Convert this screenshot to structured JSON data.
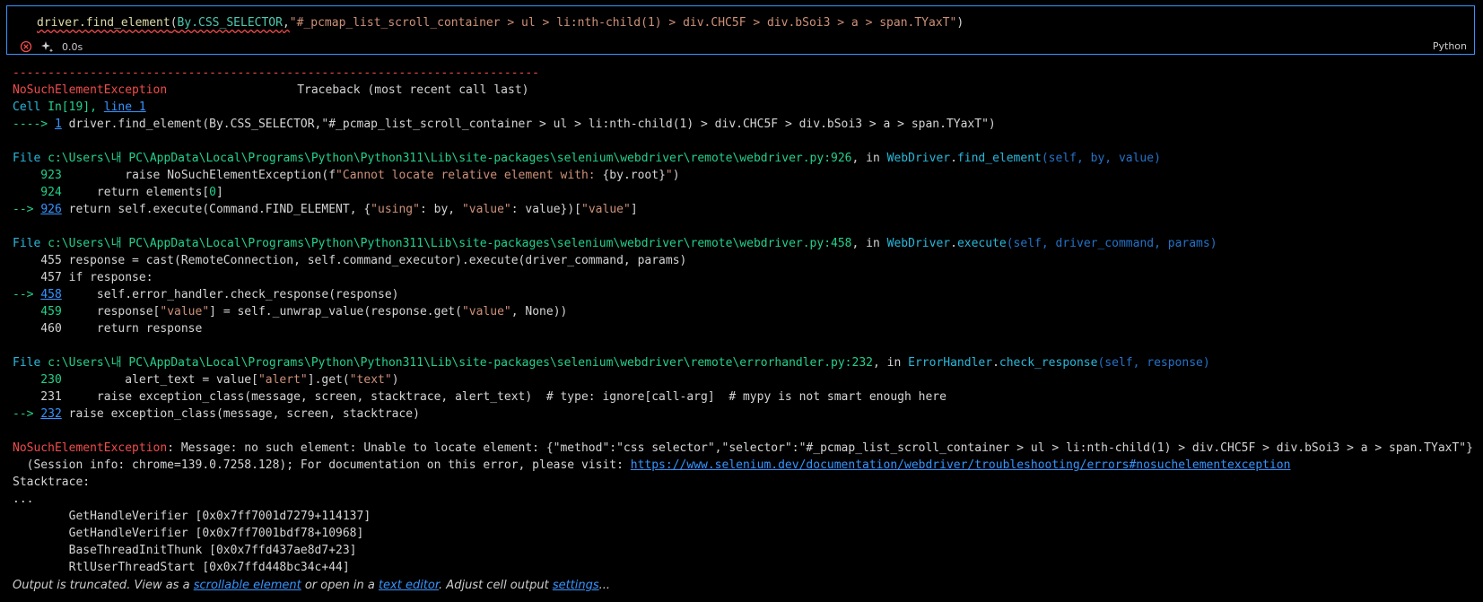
{
  "cell": {
    "code_parts": {
      "fn": "driver.find_element",
      "paren": "(",
      "cls": "By.CSS_SELECTOR",
      "comma": ",",
      "selector": "\"#_pcmap_list_scroll_container > ul > li:nth-child(1) > div.CHC5F > div.bSoi3 > a > span.TYaxT\"",
      "close": ")"
    },
    "exec_time": "0.0s",
    "language": "Python",
    "status": "error"
  },
  "traceback": {
    "dashes": "---------------------------------------------------------------------------",
    "exception_name": "NoSuchElementException",
    "header": "Traceback (most recent call last)",
    "cell_label": "Cell ",
    "cell_in": "In[19], ",
    "cell_line_link": "line 1",
    "arrow_main": "----> ",
    "arrow_main_num": "1",
    "main_code": " driver.find_element(By.CSS_SELECTOR,\"#_pcmap_list_scroll_container > ul > li:nth-child(1) > div.CHC5F > div.bSoi3 > a > span.TYaxT\")",
    "frames": [
      {
        "file_label": "File ",
        "path": "c:\\Users\\내 PC\\AppData\\Local\\Programs\\Python\\Python311\\Lib\\site-packages\\selenium\\webdriver\\remote\\webdriver.py:926",
        "in_text": ", in ",
        "cls": "WebDriver",
        "dot": ".",
        "method": "find_element",
        "args": "(self, by, value)"
      },
      {
        "file_label": "File ",
        "path": "c:\\Users\\내 PC\\AppData\\Local\\Programs\\Python\\Python311\\Lib\\site-packages\\selenium\\webdriver\\remote\\webdriver.py:458",
        "in_text": ", in ",
        "cls": "WebDriver",
        "dot": ".",
        "method": "execute",
        "args": "(self, driver_command, params)"
      },
      {
        "file_label": "File ",
        "path": "c:\\Users\\내 PC\\AppData\\Local\\Programs\\Python\\Python311\\Lib\\site-packages\\selenium\\webdriver\\remote\\errorhandler.py:232",
        "in_text": ", in ",
        "cls": "ErrorHandler",
        "dot": ".",
        "method": "check_response",
        "args": "(self, response)"
      }
    ],
    "f1": {
      "l923_num": "    923 ",
      "l923_a": "        raise NoSuchElementException(f",
      "l923_str": "\"Cannot locate relative element with: ",
      "l923_b": "{by.root}",
      "l923_str2": "\"",
      "l923_c": ")",
      "l924_num": "    924 ",
      "l924_a": "    return elements[",
      "l924_zero": "0",
      "l924_b": "]",
      "arrow": "--> ",
      "l926_num": "926",
      "l926_a": " return self.execute(Command.FIND_ELEMENT, {",
      "l926_s1": "\"using\"",
      "l926_b": ": by, ",
      "l926_s2": "\"value\"",
      "l926_c": ": value})[",
      "l926_s3": "\"value\"",
      "l926_d": "]"
    },
    "f2": {
      "l455": "    455 response = cast(RemoteConnection, self.command_executor).execute(driver_command, params)",
      "l457": "    457 if response:",
      "arrow": "--> ",
      "l458_num": "458",
      "l458_a": "     self.error_handler.check_response(response)",
      "l459_num": "    459 ",
      "l459_a": "    response[",
      "l459_s1": "\"value\"",
      "l459_b": "] = self._unwrap_value(response.get(",
      "l459_s2": "\"value\"",
      "l459_c": ", None))",
      "l460": "    460     return response"
    },
    "f3": {
      "l230_num": "    230 ",
      "l230_a": "        alert_text = value[",
      "l230_s1": "\"alert\"",
      "l230_b": "].get(",
      "l230_s2": "\"text\"",
      "l230_c": ")",
      "l231": "    231     raise exception_class(message, screen, stacktrace, alert_text)  # type: ignore[call-arg]  # mypy is not smart enough here",
      "arrow": "--> ",
      "l232_num": "232",
      "l232_a": " raise exception_class(message, screen, stacktrace)"
    },
    "final_exc": "NoSuchElementException",
    "final_msg": ": Message: no such element: Unable to locate element: {\"method\":\"css selector\",\"selector\":\"#_pcmap_list_scroll_container > ul > li:nth-child(1) > div.CHC5F > div.bSoi3 > a > span.TYaxT\"}",
    "session_info": "  (Session info: chrome=139.0.7258.128); For documentation on this error, please visit: ",
    "doc_link": "https://www.selenium.dev/documentation/webdriver/troubleshooting/errors#nosuchelementexception",
    "stacktrace_label": "Stacktrace:",
    "ellipsis": "...",
    "stack": [
      "        GetHandleVerifier [0x0x7ff7001d7279+114137]",
      "        GetHandleVerifier [0x0x7ff7001bdf78+10968]",
      "        BaseThreadInitThunk [0x0x7ffd437ae8d7+23]",
      "        RtlUserThreadStart [0x0x7ffd448bc34c+44]"
    ]
  },
  "truncation": {
    "prefix": "Output is truncated. View as a ",
    "link1": "scrollable element",
    "mid1": " or open in a ",
    "link2": "text editor",
    "mid2": ". Adjust cell output ",
    "link3": "settings",
    "suffix": "..."
  },
  "colors": {
    "accent": "#3794ff",
    "error": "#f14c4c",
    "green": "#23d18b",
    "cyan": "#29b8db",
    "dim_blue": "#2472c8"
  }
}
